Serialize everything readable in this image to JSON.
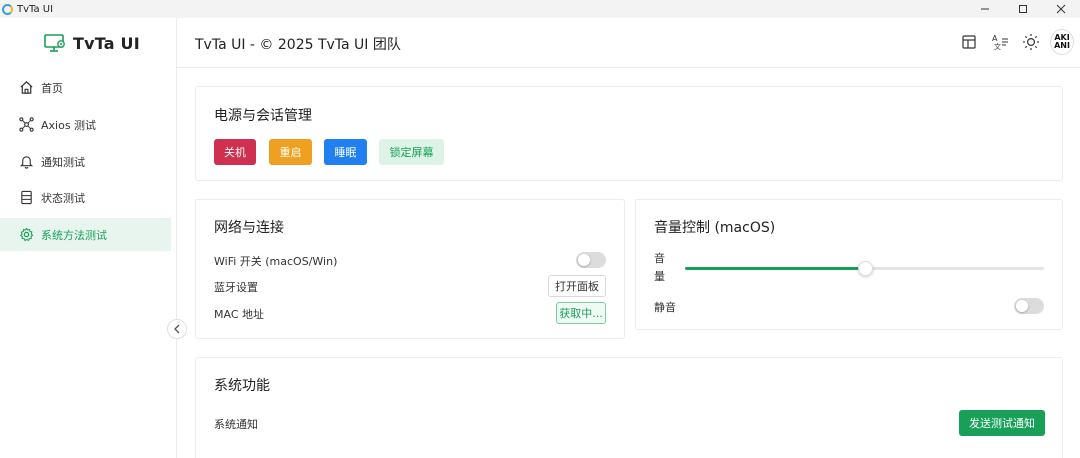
{
  "window": {
    "title": "TvTa UI",
    "controls": [
      "minimize-icon",
      "maximize-icon",
      "close-icon"
    ]
  },
  "sidebar": {
    "brand": "TvTa UI",
    "brand_icon": "monitor-settings-icon",
    "items": [
      {
        "label": "首页",
        "icon": "home-icon",
        "active": false
      },
      {
        "label": "Axios 测试",
        "icon": "hub-icon",
        "active": false
      },
      {
        "label": "通知测试",
        "icon": "bell-icon",
        "active": false
      },
      {
        "label": "状态测试",
        "icon": "storage-icon",
        "active": false
      },
      {
        "label": "系统方法测试",
        "icon": "gear-icon",
        "active": true
      }
    ],
    "collapse_icon": "chevron-left-icon"
  },
  "header": {
    "title": "TvTa UI - © 2025 TvTa UI 团队",
    "icons": [
      "layout-icon",
      "translate-icon",
      "sun-icon"
    ],
    "avatar_text": "AKI ANI"
  },
  "power": {
    "title": "电源与会话管理",
    "buttons": [
      "关机",
      "重启",
      "睡眠",
      "锁定屏幕"
    ]
  },
  "network": {
    "title": "网络与连接",
    "wifi_label": "WiFi 开关 (macOS/Win)",
    "wifi_on": false,
    "bluetooth_label": "蓝牙设置",
    "bluetooth_button": "打开面板",
    "mac_label": "MAC 地址",
    "mac_value": "获取中..."
  },
  "volume": {
    "title": "音量控制 (macOS)",
    "volume_label": "音量",
    "volume_level": 0.5,
    "mute_label": "静音",
    "mute_on": false
  },
  "system": {
    "title": "系统功能",
    "notify_label": "系统通知",
    "notify_button": "发送测试通知"
  },
  "colors": {
    "accent": "#18a058",
    "danger": "#d03050",
    "warning": "#f0a020",
    "info": "#2080f0"
  }
}
